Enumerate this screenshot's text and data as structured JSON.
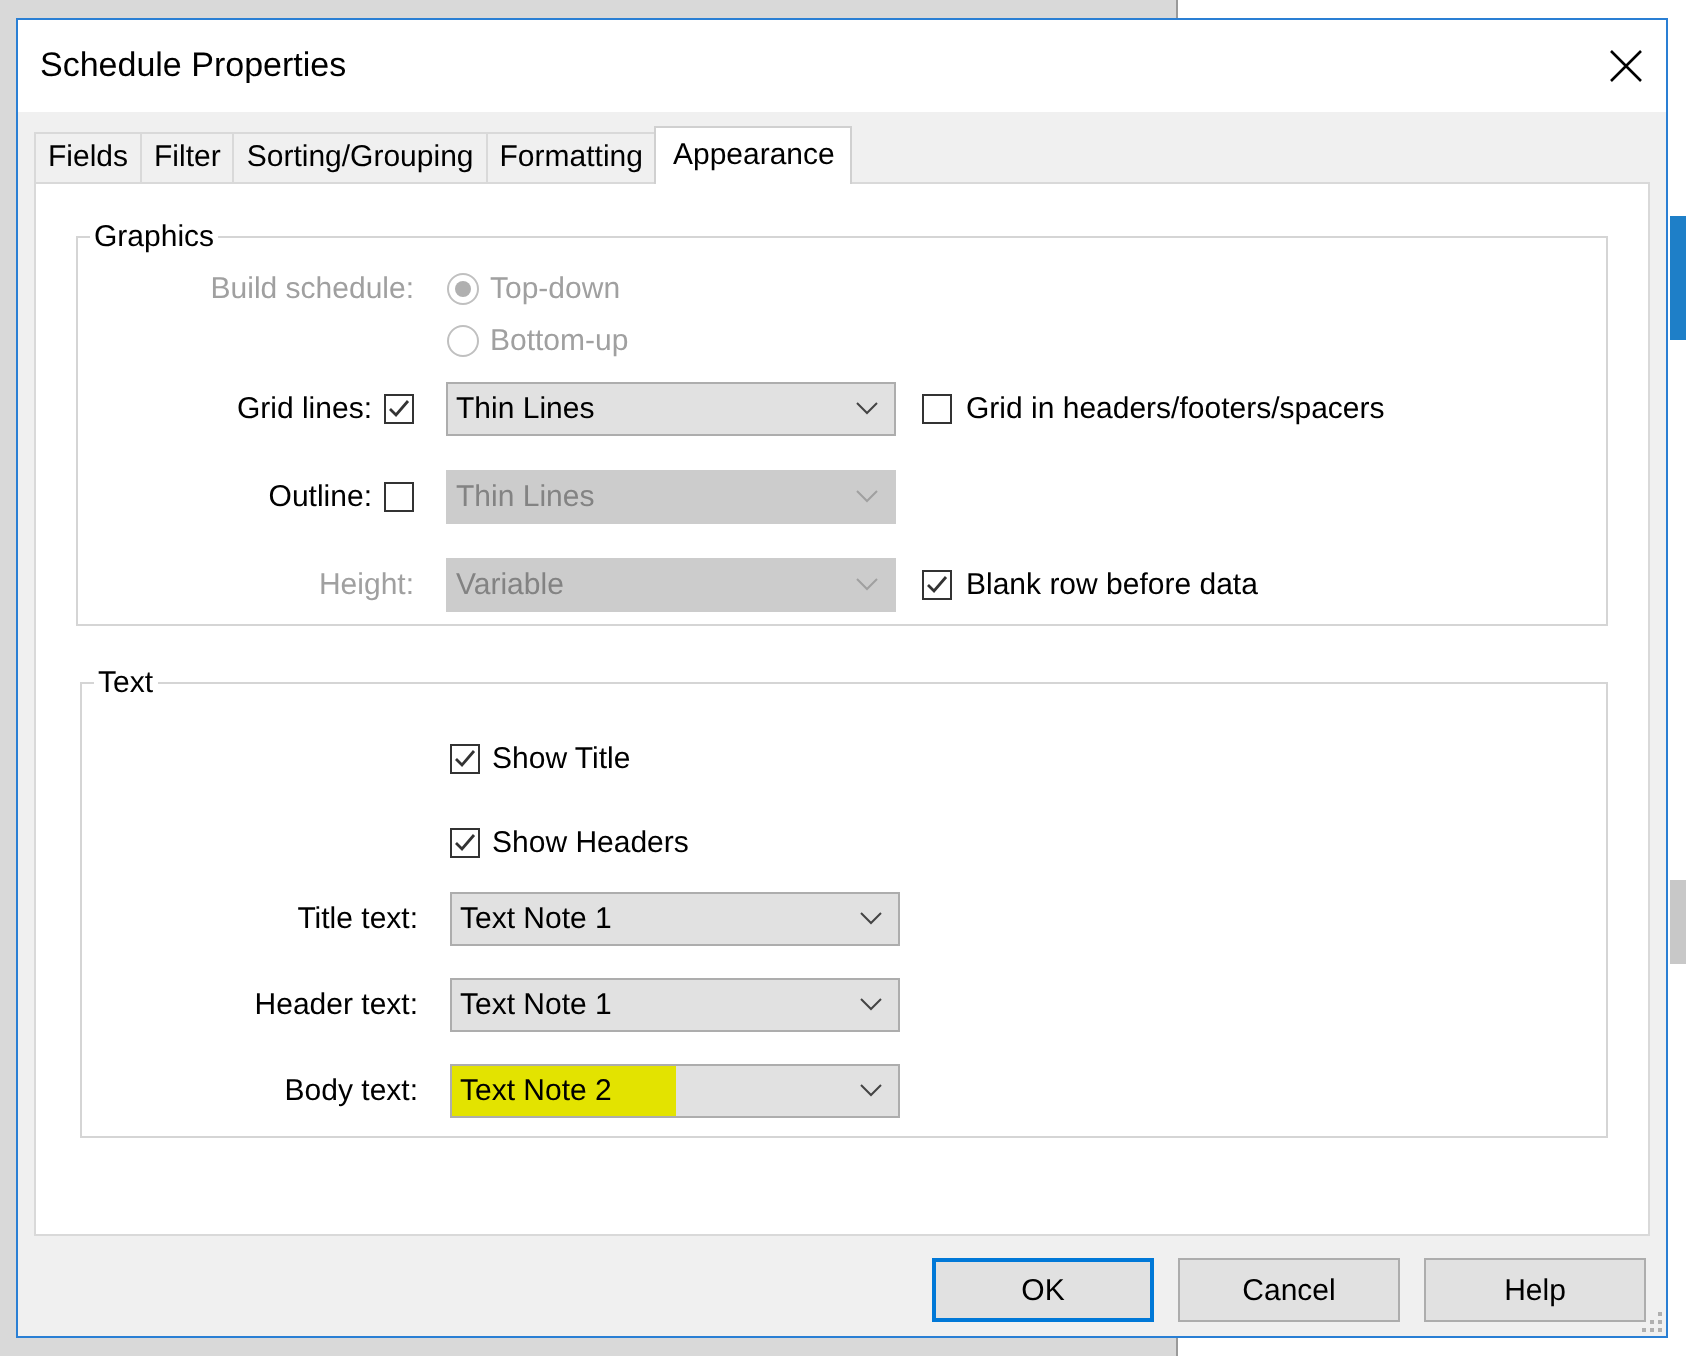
{
  "window": {
    "title": "Schedule Properties"
  },
  "tabs": [
    {
      "label": "Fields",
      "selected": false
    },
    {
      "label": "Filter",
      "selected": false
    },
    {
      "label": "Sorting/Grouping",
      "selected": false
    },
    {
      "label": "Formatting",
      "selected": false
    },
    {
      "label": "Appearance",
      "selected": true
    }
  ],
  "graphics": {
    "title": "Graphics",
    "rows": [
      {
        "kind": "radio",
        "label": "Build schedule:",
        "disabled": true,
        "options": [
          {
            "label": "Top-down",
            "selected": true,
            "disabled": true
          },
          {
            "label": "Bottom-up",
            "selected": false,
            "disabled": true
          }
        ]
      },
      {
        "kind": "dropdown",
        "label": "Grid lines:",
        "disabled": false,
        "checkbox": {
          "checked": true
        },
        "value": "Thin Lines",
        "value_disabled": false,
        "side_checkbox": {
          "label": "Grid in headers/footers/spacers",
          "checked": false
        }
      },
      {
        "kind": "dropdown",
        "label": "Outline:",
        "disabled": false,
        "checkbox": {
          "checked": false
        },
        "value": "Thin Lines",
        "value_disabled": true
      },
      {
        "kind": "dropdown",
        "label": "Height:",
        "disabled": true,
        "value": "Variable",
        "value_disabled": true,
        "side_checkbox": {
          "label": "Blank row before data",
          "checked": true
        }
      }
    ]
  },
  "text": {
    "title": "Text",
    "rows": [
      {
        "kind": "checkbox",
        "label": "Show Title",
        "checked": true
      },
      {
        "kind": "checkbox",
        "label": "Show Headers",
        "checked": true
      },
      {
        "kind": "dropdown",
        "label": "Title text:",
        "disabled": false,
        "value": "Text Note 1",
        "value_disabled": false,
        "highlighted": false
      },
      {
        "kind": "dropdown",
        "label": "Header text:",
        "disabled": false,
        "value": "Text Note 1",
        "value_disabled": false,
        "highlighted": false
      },
      {
        "kind": "dropdown",
        "label": "Body text:",
        "disabled": false,
        "value": "Text Note 2",
        "value_disabled": false,
        "highlighted": true
      }
    ]
  },
  "buttons": [
    {
      "label": "OK",
      "default": true
    },
    {
      "label": "Cancel",
      "default": false
    },
    {
      "label": "Help",
      "default": false
    }
  ]
}
